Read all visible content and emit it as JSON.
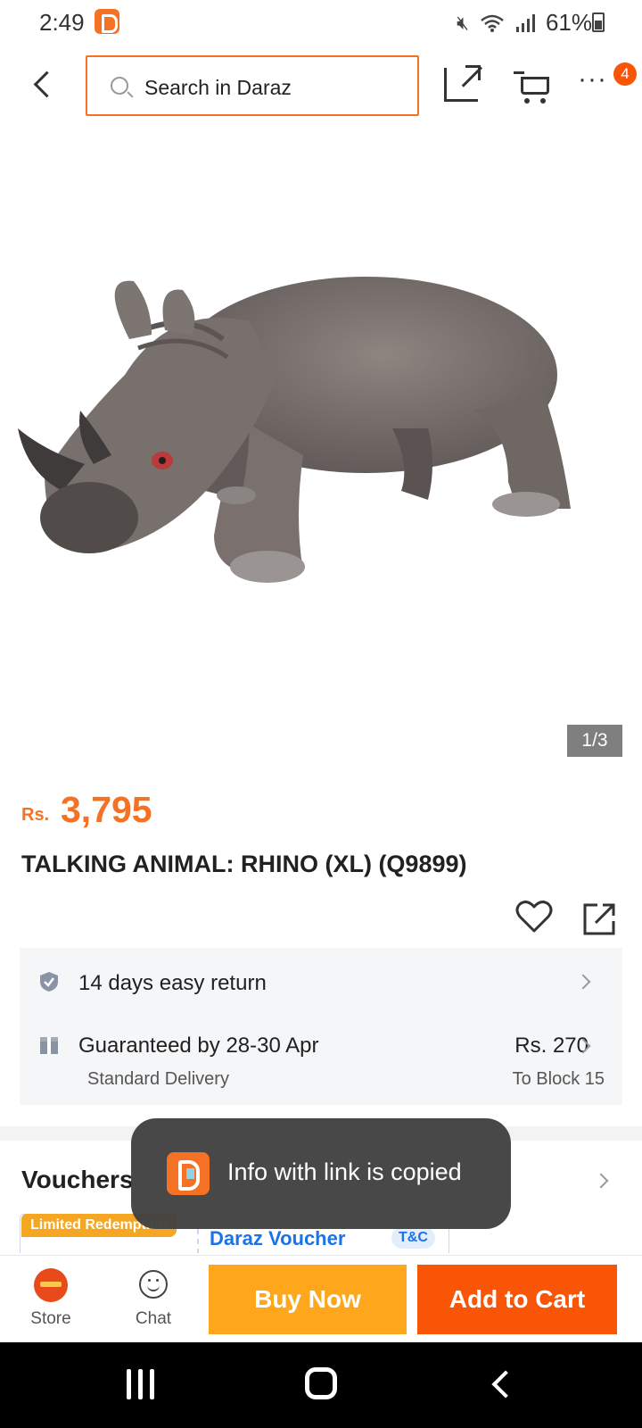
{
  "status_bar": {
    "time": "2:49",
    "battery": "61%",
    "icons": [
      "mute-icon",
      "wifi-icon",
      "signal-icon",
      "battery-icon"
    ]
  },
  "header": {
    "search_placeholder": "Search in Daraz",
    "more_badge": "4"
  },
  "gallery": {
    "pager": "1/3",
    "image_subject": "rhino toy"
  },
  "product": {
    "currency": "Rs.",
    "price": "3,795",
    "title": "TALKING ANIMAL: RHINO (XL) (Q9899)"
  },
  "service": {
    "return_label": "14 days easy return",
    "guarantee_label": "Guaranteed by 28-30 Apr",
    "delivery_type": "Standard Delivery",
    "delivery_fee": "Rs. 270",
    "delivery_to": "To Block 15"
  },
  "vouchers": {
    "title": "Vouchers",
    "tag": "Limited Redemption",
    "name": "Daraz Voucher",
    "tc": "T&C"
  },
  "toast": {
    "message": "Info with link is copied"
  },
  "action_bar": {
    "store_label": "Store",
    "chat_label": "Chat",
    "buy_now": "Buy Now",
    "add_to_cart": "Add to Cart"
  },
  "colors": {
    "brand_orange": "#f57224",
    "buy_now": "#fea71c",
    "add_to_cart": "#f85606",
    "voucher_blue": "#1a73e8"
  }
}
